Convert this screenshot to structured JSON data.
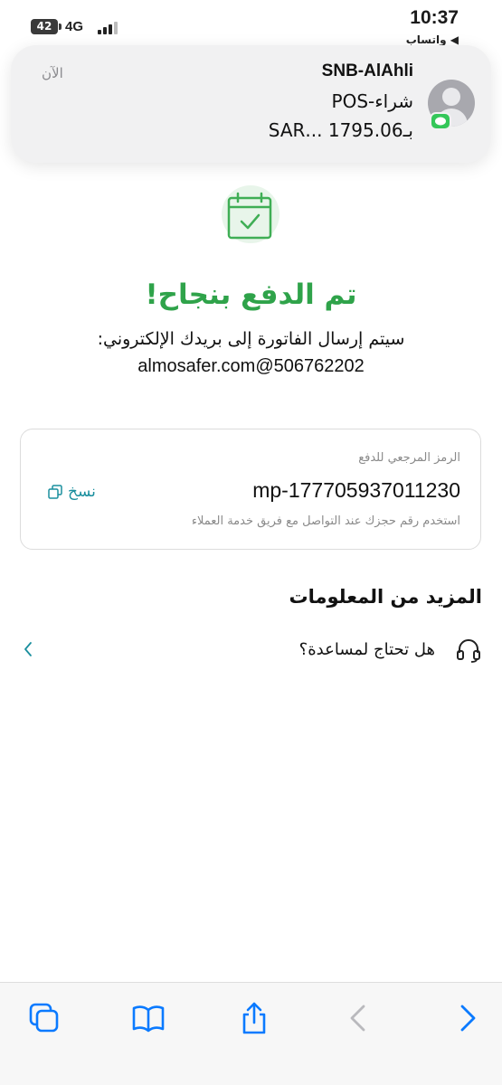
{
  "status_bar": {
    "time": "10:37",
    "back_app": "◀ واتساب",
    "network": "4G",
    "battery": "42"
  },
  "notification": {
    "sender": "SNB-AlAhli",
    "line1": "شراء-POS",
    "line2": "بـ1795.06 ...SAR",
    "time": "الآن"
  },
  "success": {
    "title": "تم الدفع بنجاح!",
    "note": "سيتم إرسال الفاتورة إلى بريدك الإلكتروني:",
    "email": "almosafer.com@506762202"
  },
  "reference": {
    "label": "الرمز المرجعي للدفع",
    "code": "mp-177705937011230",
    "hint": "استخدم رقم حجزك عند التواصل مع فريق خدمة العملاء",
    "copy_label": "نسخ"
  },
  "more_info": {
    "title": "المزيد من المعلومات",
    "help_label": "هل تحتاج لمساعدة؟"
  },
  "colors": {
    "accent_green": "#2fa34a",
    "link_teal": "#1a8f9e",
    "toolbar_blue": "#0a7aff"
  },
  "toolbar_icons": [
    "tabs-icon",
    "bookmarks-icon",
    "share-icon",
    "back-icon",
    "forward-icon"
  ]
}
